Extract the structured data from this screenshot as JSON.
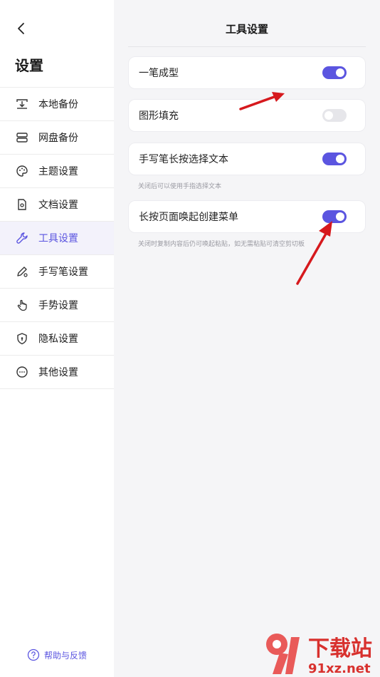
{
  "sidebar": {
    "title": "设置",
    "items": [
      {
        "label": "本地备份",
        "icon": "local-backup-icon",
        "active": false
      },
      {
        "label": "网盘备份",
        "icon": "cloud-backup-icon",
        "active": false
      },
      {
        "label": "主题设置",
        "icon": "palette-icon",
        "active": false
      },
      {
        "label": "文档设置",
        "icon": "document-gear-icon",
        "active": false
      },
      {
        "label": "工具设置",
        "icon": "wrench-icon",
        "active": true
      },
      {
        "label": "手写笔设置",
        "icon": "pen-gear-icon",
        "active": false
      },
      {
        "label": "手势设置",
        "icon": "hand-gesture-icon",
        "active": false
      },
      {
        "label": "隐私设置",
        "icon": "shield-lock-icon",
        "active": false
      },
      {
        "label": "其他设置",
        "icon": "more-dots-icon",
        "active": false
      }
    ],
    "help": "帮助与反馈"
  },
  "main": {
    "title": "工具设置",
    "settings": [
      {
        "label": "一笔成型",
        "enabled": true,
        "hint": ""
      },
      {
        "label": "图形填充",
        "enabled": false,
        "hint": ""
      },
      {
        "label": "手写笔长按选择文本",
        "enabled": true,
        "hint": "关闭后可以使用手指选择文本"
      },
      {
        "label": "长按页面唤起创建菜单",
        "enabled": true,
        "hint": "关闭时复制内容后仍可唤起粘贴，如无需粘贴可清空剪切板"
      }
    ]
  },
  "colors": {
    "accent": "#5b55e0",
    "arrow": "#d6191d"
  },
  "watermark": {
    "brand": "下载站",
    "domain": "91xz.net"
  }
}
